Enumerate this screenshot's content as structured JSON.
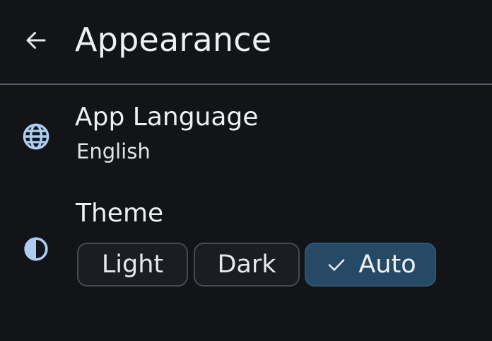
{
  "header": {
    "back_icon": "arrow-left-icon",
    "title": "Appearance"
  },
  "language": {
    "icon": "globe-icon",
    "title": "App Language",
    "value": "English"
  },
  "theme": {
    "icon": "contrast-icon",
    "title": "Theme",
    "options": [
      {
        "label": "Light",
        "selected": false
      },
      {
        "label": "Dark",
        "selected": false
      },
      {
        "label": "Auto",
        "selected": true
      }
    ],
    "selected_check_icon": "checkmark-icon"
  },
  "colors": {
    "background": "#121417",
    "divider": "#5a5f66",
    "icon_accent": "#aecbf0",
    "chip_selected_bg": "#264a66",
    "chip_border": "#464b52"
  }
}
